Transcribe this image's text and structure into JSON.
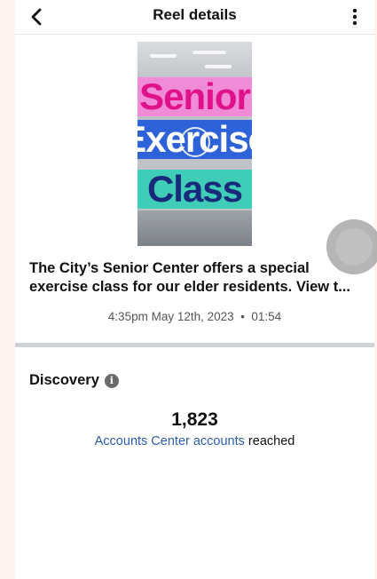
{
  "header": {
    "title": "Reel details",
    "back_icon": "chevron-left-icon",
    "more_icon": "more-vertical-icon"
  },
  "reel": {
    "thumbnail_words": [
      "Senior",
      "Exercise",
      "Class"
    ],
    "caption": "The City’s Senior Center offers a special exercise class for our elder residents. View t...",
    "time": "4:35pm May 12th, 2023",
    "separator": "•",
    "duration": "01:54"
  },
  "discovery": {
    "heading": "Discovery",
    "info_icon": "info-icon",
    "accounts_reached_value": "1,823",
    "accounts_reached_link": "Accounts Center accounts",
    "accounts_reached_suffix": " reached"
  },
  "colors": {
    "link": "#2a5db0",
    "divider": "#cfd3d8",
    "page_bg": "#fdf4f0"
  }
}
